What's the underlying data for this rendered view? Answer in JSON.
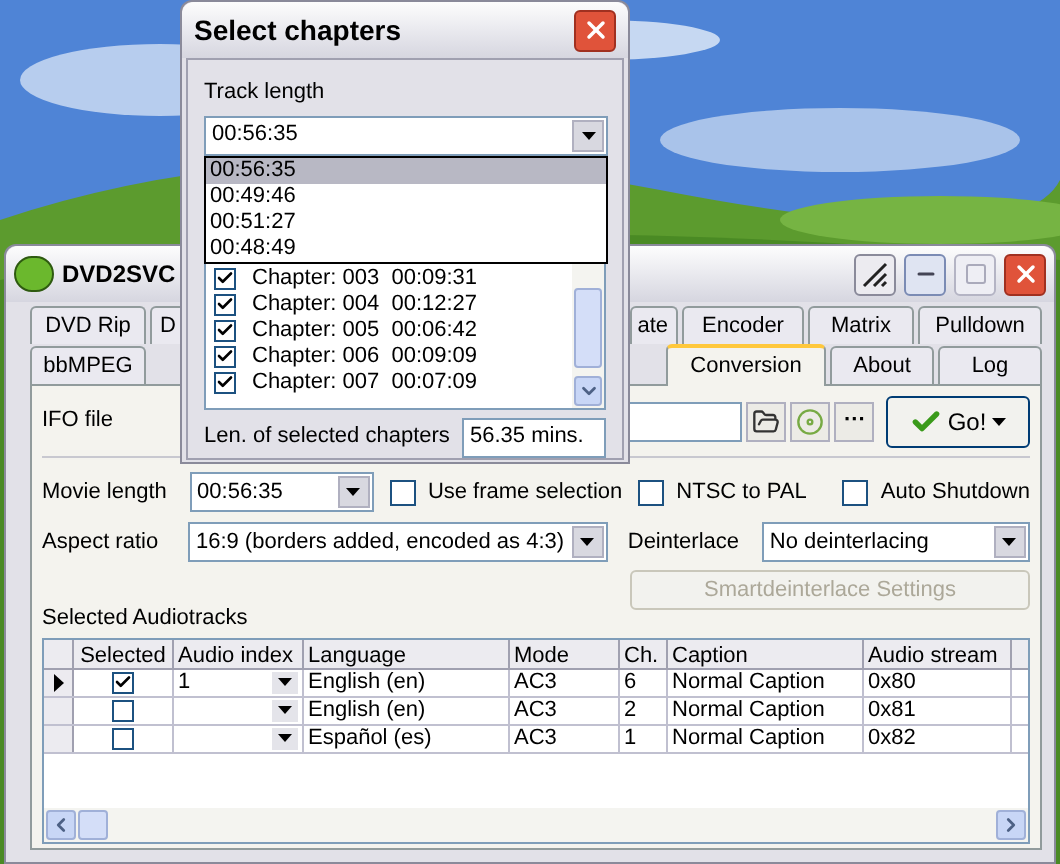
{
  "main_window": {
    "title": "DVD2SVC",
    "tabs_row_1": [
      {
        "label": "DVD Rip",
        "selected": false
      },
      {
        "label": "D",
        "selected": false
      },
      {
        "label": "ate",
        "selected": false
      },
      {
        "label": "Encoder",
        "selected": false
      },
      {
        "label": "Matrix",
        "selected": false
      },
      {
        "label": "Pulldown",
        "selected": false
      }
    ],
    "tabs_row_2": [
      {
        "label": "bbMPEG",
        "selected": false
      },
      {
        "label": "Conversion",
        "selected": true
      },
      {
        "label": "About",
        "selected": false
      },
      {
        "label": "Log",
        "selected": false
      }
    ],
    "ifo_file": {
      "label": "IFO file"
    },
    "browse_button": "···",
    "go_button": "Go!",
    "movie_length": {
      "label": "Movie length",
      "value": "00:56:35"
    },
    "options": [
      {
        "label": "Use frame selection",
        "checked": false
      },
      {
        "label": "NTSC to PAL",
        "checked": false
      },
      {
        "label": "Auto Shutdown",
        "checked": false
      }
    ],
    "aspect_ratio": {
      "label": "Aspect ratio",
      "value": "16:9 (borders added, encoded as 4:3)"
    },
    "deinterlace": {
      "label": "Deinterlace",
      "value": "No deinterlacing"
    },
    "smartdeinterlace_button": {
      "label": "Smartdeinterlace Settings",
      "disabled": true
    },
    "audiotracks": {
      "title": "Selected Audiotracks",
      "columns": [
        "Selected",
        "Audio index",
        "Language",
        "Mode",
        "Ch.",
        "Caption",
        "Audio stream"
      ],
      "rows": [
        {
          "current": true,
          "selected": true,
          "audio_index": "1",
          "language": "English (en)",
          "mode": "AC3",
          "ch": "6",
          "caption": "Normal Caption",
          "audio_stream": "0x80"
        },
        {
          "current": false,
          "selected": false,
          "audio_index": "",
          "language": "English (en)",
          "mode": "AC3",
          "ch": "2",
          "caption": "Normal Caption",
          "audio_stream": "0x81"
        },
        {
          "current": false,
          "selected": false,
          "audio_index": "",
          "language": "Español (es)",
          "mode": "AC3",
          "ch": "1",
          "caption": "Normal Caption",
          "audio_stream": "0x82"
        }
      ]
    }
  },
  "dialog": {
    "title": "Select chapters",
    "track_length": {
      "label": "Track length",
      "value": "00:56:35"
    },
    "dropdown_options": [
      {
        "label": "00:56:35",
        "selected": true
      },
      {
        "label": "00:49:46",
        "selected": false
      },
      {
        "label": "00:51:27",
        "selected": false
      },
      {
        "label": "00:48:49",
        "selected": false
      }
    ],
    "chapters": [
      {
        "label": "Chapter: 003  00:09:31",
        "checked": true
      },
      {
        "label": "Chapter: 004  00:12:27",
        "checked": true
      },
      {
        "label": "Chapter: 005  00:06:42",
        "checked": true
      },
      {
        "label": "Chapter: 006  00:09:09",
        "checked": true
      },
      {
        "label": "Chapter: 007  00:07:09",
        "checked": true
      }
    ],
    "selected_length": {
      "label": "Len. of selected chapters",
      "value": "56.35 mins."
    }
  }
}
